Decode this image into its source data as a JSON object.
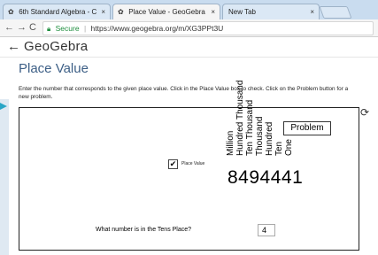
{
  "browser": {
    "tabs": [
      {
        "label": "6th Standard Algebra - C",
        "icon": "geogebra-icon",
        "active": false
      },
      {
        "label": "Place Value - GeoGebra",
        "icon": "geogebra-icon",
        "active": true
      },
      {
        "label": "New Tab",
        "icon": "",
        "active": false
      }
    ],
    "close_glyph": "×",
    "nav": {
      "back": "←",
      "forward": "→",
      "reload": "C"
    },
    "address": {
      "secure_label": "Secure",
      "separator": "|",
      "url": "https://www.geogebra.org/m/XG3PPt3U"
    }
  },
  "header": {
    "back_glyph": "←",
    "brand": "GeoGebra"
  },
  "page": {
    "title": "Place Value",
    "instructions": "Enter the number that corresponds to the given place value.  Click in the Place Value box to check.  Click on the Problem button for a new problem."
  },
  "applet": {
    "problem_button": "Problem",
    "refresh_glyph": "⟳",
    "checkbox_label": "Place Value",
    "checkbox_checked": true,
    "check_glyph": "✔",
    "place_labels": [
      "Million",
      "Hundred Thousand",
      "Ten Thousand",
      "Thousand",
      "Hundred",
      "Ten",
      "One"
    ],
    "number": "8494441",
    "question": "What number is in the Tens Place?",
    "answer": "4"
  }
}
